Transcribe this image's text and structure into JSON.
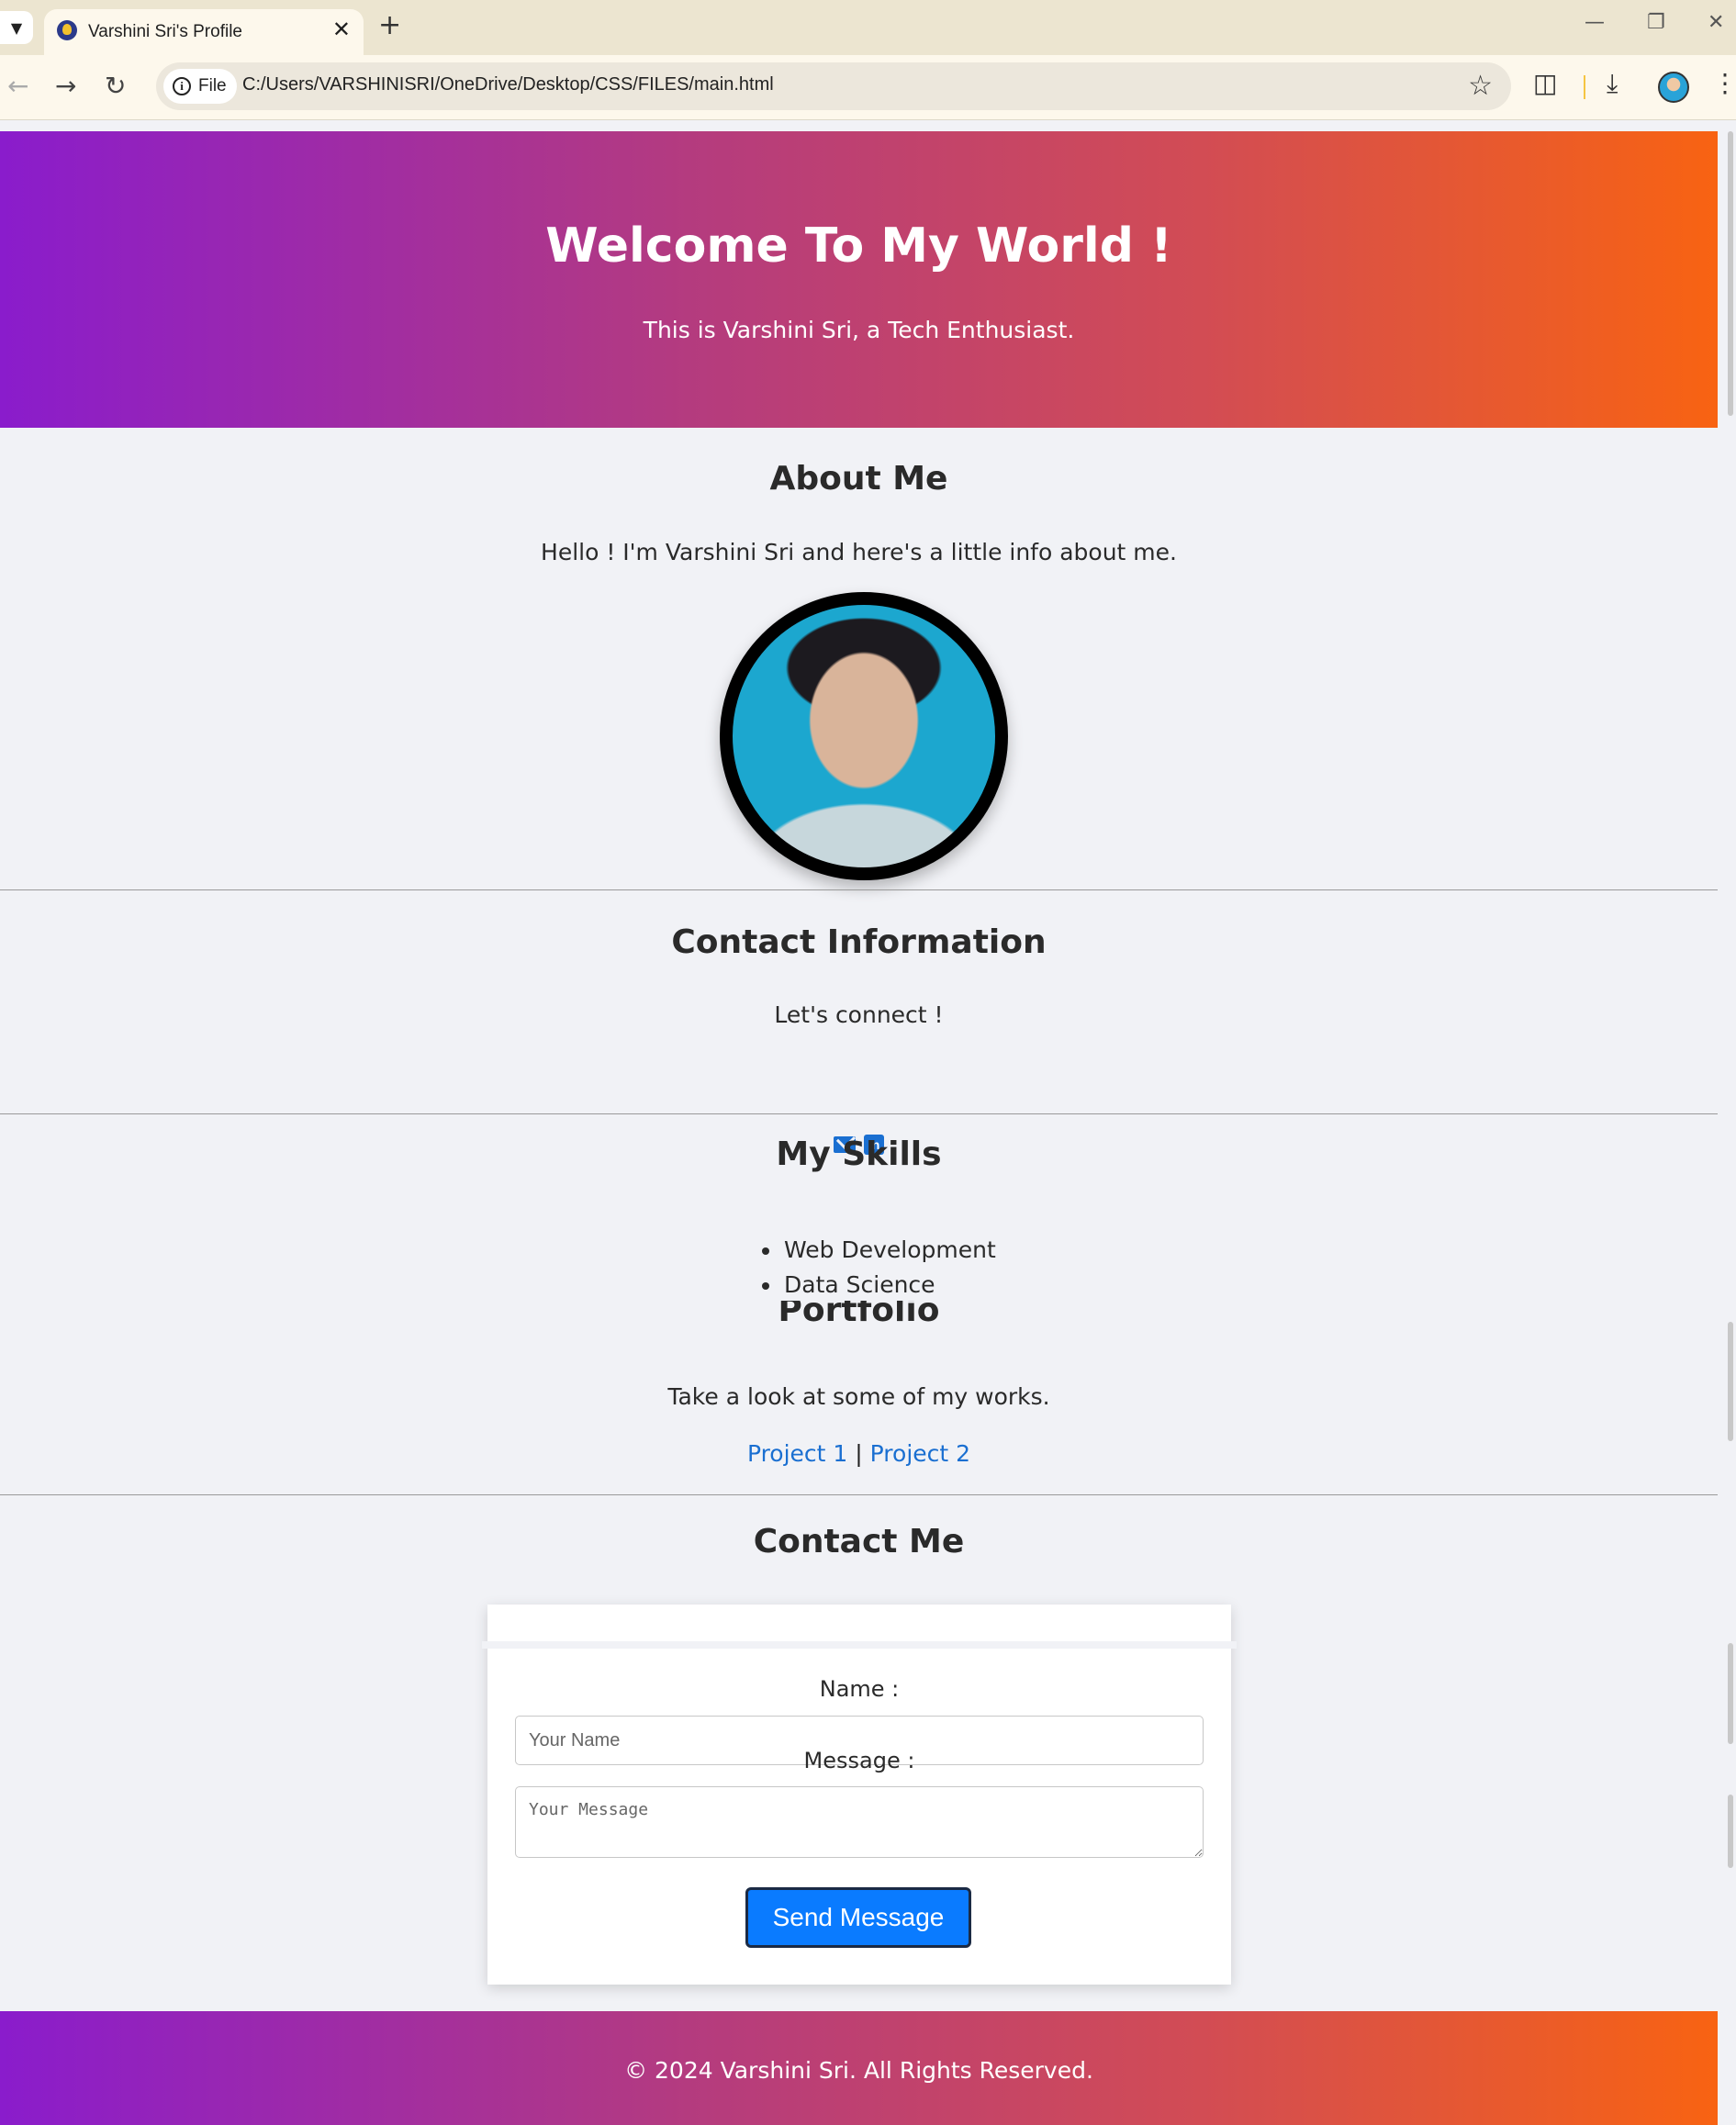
{
  "browser": {
    "tab_title": "Varshini Sri's Profile",
    "tab_close": "✕",
    "new_tab": "+",
    "chip_label": "File",
    "url": "C:/Users/VARSHINISRI/OneDrive/Desktop/CSS/FILES/main.html",
    "icons": [
      "tab-search-icon",
      "site-favicon",
      "close-icon",
      "new-tab-icon",
      "minimize-icon",
      "restore-icon",
      "close-window-icon",
      "back-icon",
      "forward-icon",
      "reload-icon",
      "info-icon",
      "star-icon",
      "extensions-icon",
      "download-icon",
      "profile-avatar-icon",
      "menu-icon"
    ]
  },
  "hero": {
    "title": "Welcome To My World !",
    "subtitle": "This is Varshini Sri, a Tech Enthusiast."
  },
  "about": {
    "title": "About Me",
    "text": "Hello ! I'm Varshini Sri and here's a little info about me."
  },
  "contact_info": {
    "title": "Contact Information",
    "text": "Let's connect !",
    "icons": [
      "mail-icon",
      "linkedin-icon"
    ]
  },
  "skills": {
    "title": "My Skills",
    "items": [
      "Web Development",
      "Data Science"
    ]
  },
  "portfolio": {
    "title": "Portfolio",
    "text": "Take a look at some of my works.",
    "links": [
      "Project 1",
      "Project 2"
    ],
    "separator": "|"
  },
  "contact_me": {
    "title": "Contact Me",
    "name_label": "Name :",
    "name_placeholder": "Your Name",
    "message_label": "Message :",
    "message_placeholder": "Your Message",
    "submit_label": "Send Message"
  },
  "footer": {
    "text": "© 2024 Varshini Sri. All Rights Reserved."
  },
  "colors": {
    "gradient_start": "#8a1ccc",
    "gradient_end": "#f86312",
    "link": "#1a6fd1",
    "button": "#0a7bff",
    "page_bg": "#f1f2f6"
  }
}
